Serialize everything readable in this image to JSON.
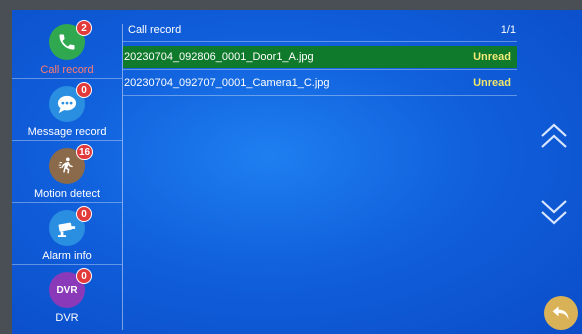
{
  "sidebar": {
    "items": [
      {
        "label": "Call record",
        "badge": "2",
        "icon": "phone-icon",
        "color": "#2fa84f"
      },
      {
        "label": "Message record",
        "badge": "0",
        "icon": "message-icon",
        "color": "#2a8fe0"
      },
      {
        "label": "Motion detect",
        "badge": "16",
        "icon": "motion-icon",
        "color": "#8a6a4a"
      },
      {
        "label": "Alarm info",
        "badge": "0",
        "icon": "camera-alarm-icon",
        "color": "#2a8fe0"
      },
      {
        "label": "DVR",
        "badge": "0",
        "icon": "dvr-icon",
        "icon_text": "DVR",
        "color": "#8a3ab8"
      }
    ]
  },
  "main": {
    "title": "Call record",
    "page": "1/1",
    "records": [
      {
        "name": "20230704_092806_0001_Door1_A.jpg",
        "status": "Unread",
        "selected": true
      },
      {
        "name": "20230704_092707_0001_Camera1_C.jpg",
        "status": "Unread",
        "selected": false
      }
    ]
  },
  "colors": {
    "background": "#1160dc",
    "selected_row": "#0f7a2c",
    "unread": "#f0e66a",
    "active_label": "#ff7a6e",
    "badge": "#e23a3a",
    "back_button": "#d9b257"
  }
}
